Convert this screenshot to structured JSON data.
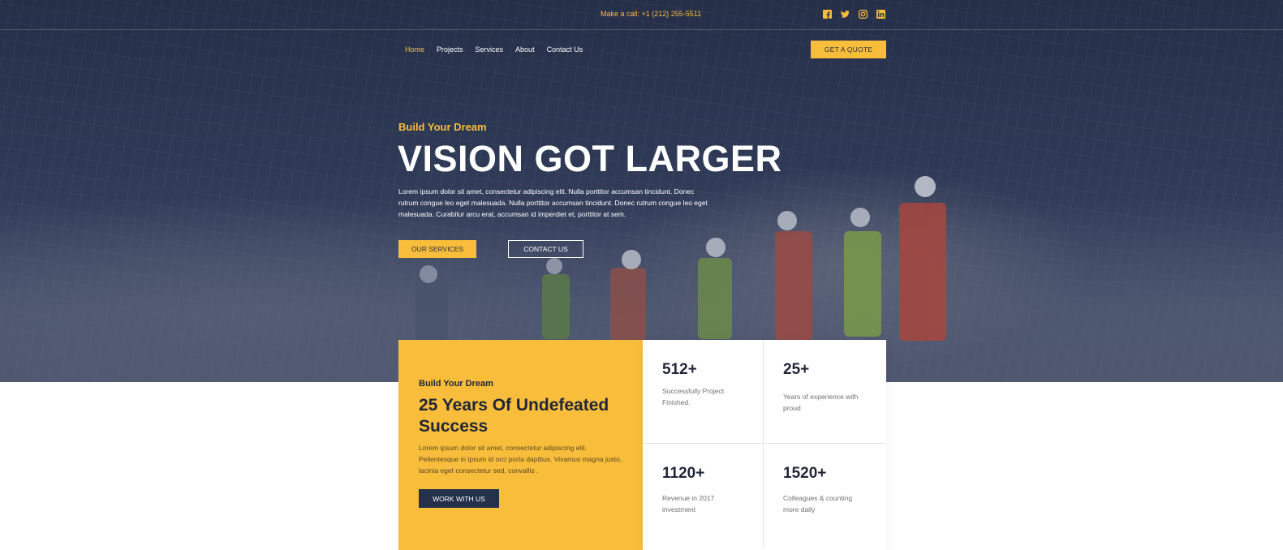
{
  "topbar": {
    "call_text": "Make a call: +1 (212) 255-5511",
    "social_icons": [
      "facebook-icon",
      "twitter-icon",
      "instagram-icon",
      "linkedin-icon"
    ],
    "icon_color": "#f8bd3a"
  },
  "nav": {
    "items": [
      {
        "label": "Home",
        "active": true
      },
      {
        "label": "Projects",
        "active": false
      },
      {
        "label": "Services",
        "active": false
      },
      {
        "label": "About",
        "active": false
      },
      {
        "label": "Contact Us",
        "active": false
      }
    ],
    "quote_button": "GET A QUOTE"
  },
  "hero": {
    "subtitle": "Build Your Dream",
    "title": "VISION GOT LARGER",
    "body": "Lorem ipsum dolor sit amet, consectetur adipiscing elit. Nulla porttitor accumsan tincidunt. Donec rutrum congue leo eget malesuada. Nulla porttitor accumsan tincidunt. Donec rutrum congue leo eget malesuada. Curabitur arcu erat, accumsan id imperdiet et, porttitor at sem.",
    "primary_button": "OUR SERVICES",
    "secondary_button": "CONTACT US"
  },
  "feature": {
    "subtitle": "Build Your Dream",
    "title": "25 Years Of Undefeated Success",
    "body": "Lorem ipsum dolor sit amet, consectetur adipiscing elit. Pellentesque in ipsum id orci porta dapibus. Vivamus magna justo, lacinia eget consectetur sed, convallis .",
    "button": "WORK WITH US"
  },
  "stats": [
    {
      "value": "512+",
      "label": "Successfully Project Finished."
    },
    {
      "value": "25+",
      "label": "Years of experience with proud"
    },
    {
      "value": "1120+",
      "label": "Revenue in 2017 investment"
    },
    {
      "value": "1520+",
      "label": "Colleagues & counting more daily"
    }
  ],
  "colors": {
    "accent": "#f8bd3a",
    "navy": "#25304a",
    "hero_overlay": "#2f3a56"
  }
}
